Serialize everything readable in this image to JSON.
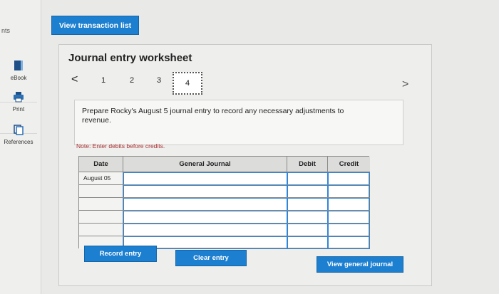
{
  "sidebar": {
    "partial_label": "nts",
    "items": [
      {
        "label": "eBook",
        "icon": "ebook-icon"
      },
      {
        "label": "Print",
        "icon": "print-icon"
      },
      {
        "label": "References",
        "icon": "references-icon"
      }
    ]
  },
  "header": {
    "view_transactions_label": "View transaction list"
  },
  "worksheet": {
    "title": "Journal entry worksheet",
    "steps": [
      "1",
      "2",
      "3",
      "4"
    ],
    "active_step": "4",
    "prompt": "Prepare Rocky's August 5 journal entry to record any necessary adjustments to revenue.",
    "note": "Note: Enter debits before credits."
  },
  "table": {
    "columns": [
      "Date",
      "General Journal",
      "Debit",
      "Credit"
    ],
    "rows": [
      {
        "date": "August 05",
        "account": "",
        "debit": "",
        "credit": ""
      },
      {
        "date": "",
        "account": "",
        "debit": "",
        "credit": ""
      },
      {
        "date": "",
        "account": "",
        "debit": "",
        "credit": ""
      },
      {
        "date": "",
        "account": "",
        "debit": "",
        "credit": ""
      },
      {
        "date": "",
        "account": "",
        "debit": "",
        "credit": ""
      },
      {
        "date": "",
        "account": "",
        "debit": "",
        "credit": ""
      }
    ]
  },
  "buttons": {
    "record": "Record entry",
    "clear": "Clear entry",
    "view_general_journal": "View general journal"
  },
  "colors": {
    "accent": "#1c7fd0",
    "note": "#aa3333"
  }
}
